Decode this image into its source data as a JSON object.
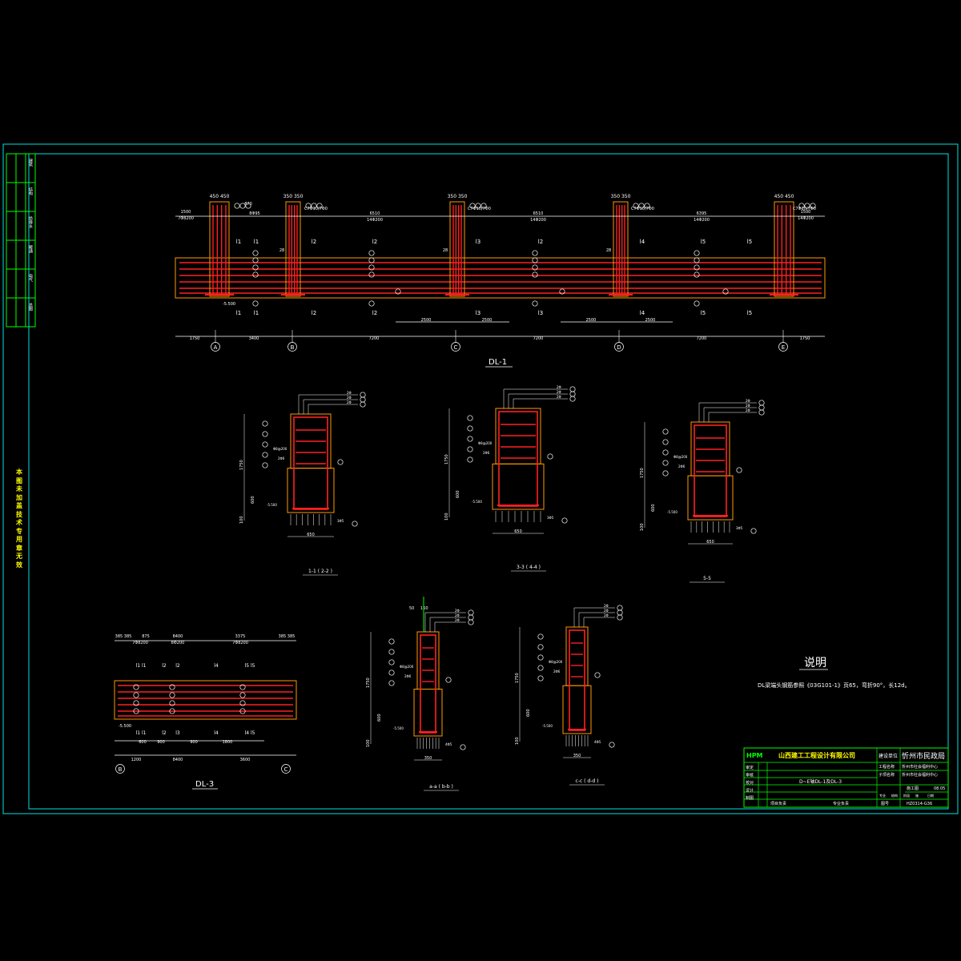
{
  "drawing_title": "DL-1",
  "dl1": {
    "axis_labels": [
      "A",
      "B",
      "C",
      "D",
      "E"
    ],
    "top_dims": [
      "1500",
      "7Φ8200",
      "870",
      "8Φ95",
      "6510",
      "14Φ200",
      "6510",
      "14Φ200",
      "6395",
      "14Φ200",
      "1500",
      "14Φ200"
    ],
    "column_dims": [
      "450 450",
      "350 350",
      "350 350",
      "350 350",
      "450 450"
    ],
    "stirrup_note": "C7Φ10/7Φ0",
    "span_marks_top": [
      "l1",
      "l1",
      "l2",
      "l2",
      "l3",
      "l2",
      "l4",
      "l5",
      "l5"
    ],
    "span_marks_bottom": [
      "l1",
      "l1",
      "l2",
      "l2",
      "l3",
      "l3",
      "l4",
      "l5",
      "l5"
    ],
    "inner_dims": [
      "2500",
      "2500",
      "2500",
      "2500"
    ],
    "bottom_dims": [
      "1750",
      "3400",
      "7200",
      "7200",
      "7200",
      "1750"
    ],
    "elevation": "-5.500",
    "side_label": "28"
  },
  "sections": [
    {
      "id": "s1",
      "title": "1-1 ( 2-2 )",
      "width_dim": "650",
      "height_dim": "1750",
      "lower_dim": "600",
      "base_dim": "100",
      "elev": "-5.500",
      "callouts": [
        "2Φ",
        "2Φ",
        "2Φ"
      ],
      "rebar_labels": [
        "Φ8@200",
        "2Φ6"
      ],
      "bottom_note": "3Φ5"
    },
    {
      "id": "s3",
      "title": "3-3 ( 4-4 )",
      "width_dim": "650",
      "height_dim": "1750",
      "lower_dim": "600",
      "base_dim": "100",
      "elev": "-5.500",
      "callouts": [
        "2Φ",
        "2Φ",
        "2Φ"
      ],
      "rebar_labels": [
        "Φ8@200",
        "2Φ6"
      ],
      "bottom_note": "3Φ5"
    },
    {
      "id": "s5",
      "title": "5-5",
      "width_dim": "650",
      "height_dim": "1750",
      "lower_dim": "600",
      "base_dim": "100",
      "elev": "-5.500",
      "callouts": [
        "2Φ",
        "2Φ",
        "2Φ"
      ],
      "rebar_labels": [
        "Φ8@200",
        "2Φ6"
      ],
      "bottom_note": "3Φ5"
    },
    {
      "id": "sa",
      "title": "a-a ( b-b )",
      "width_dim": "350",
      "height_dim": "1750",
      "lower_dim": "600",
      "base_dim": "100",
      "elev": "-5.500",
      "callouts": [
        "2Φ",
        "2Φ",
        "2Φ"
      ],
      "rebar_labels": [
        "Φ8@200",
        "2Φ6"
      ],
      "bottom_note": "4Φ5",
      "top_note": "50",
      "top_note2": "160"
    },
    {
      "id": "sc",
      "title": "c-c ( d-d )",
      "width_dim": "350",
      "height_dim": "1750",
      "lower_dim": "600",
      "base_dim": "100",
      "elev": "-5.500",
      "callouts": [
        "2Φ",
        "2Φ",
        "2Φ"
      ],
      "rebar_labels": [
        "Φ8@200",
        "2Φ6"
      ],
      "bottom_note": "4Φ5"
    }
  ],
  "dl3": {
    "title": "DL-3",
    "top_dims": [
      "385 385",
      "875",
      "8400",
      "3375",
      "385 385"
    ],
    "top_sub": [
      "7Φ8200",
      "8Φ200",
      "7Φ8200"
    ],
    "bottom_dims": [
      "1200",
      "8400",
      "3600"
    ],
    "inner_dims": [
      "600",
      "900",
      "900",
      "1800"
    ],
    "axis_labels": [
      "B",
      "C"
    ],
    "elevation": "-5.500",
    "marks_top": [
      "l1 l1",
      "l2",
      "l2",
      "l4",
      "l5 l5"
    ],
    "marks_bottom": [
      "l1 l1",
      "l2",
      "l3",
      "l4",
      "l4 l5"
    ]
  },
  "notes": {
    "heading": "说明",
    "text": "DL梁端头钢筋参照《03G101-1》页65，弯折90°，长12d。"
  },
  "left_margin_text": "本图未加盖技术专用章无效",
  "title_block": {
    "company": "山西建工工程设计有限公司",
    "logo": "HPM",
    "client_label": "建设单位",
    "client": "忻州市民政局",
    "project_label": "工程名称",
    "project": "忻州市社会福利中心",
    "subproject_label": "子项名称",
    "subproject": "忻州市社会福利中心",
    "drawing_name": "D~E轴DL-1及DL-3",
    "rows": [
      "审定",
      "审核",
      "校对",
      "设计",
      "制图"
    ],
    "bottom_left": "项目负责",
    "bottom_mid": "专业负责",
    "stage": "施工图",
    "drawing_no_label": "图号",
    "drawing_no": "HZ0314-G36",
    "date": "08.05",
    "meta_labels": [
      "专业",
      "结构",
      "阶段",
      "施",
      "日期"
    ]
  },
  "side_column": [
    "建筑",
    "结构",
    "给排水",
    "暖通",
    "电气",
    "总图"
  ],
  "colors": {
    "border": "#00e0e0",
    "red": "#ff2020",
    "yellow": "#ffff00",
    "white": "#ffffff",
    "green": "#00ff00",
    "orange": "#ff9900"
  }
}
